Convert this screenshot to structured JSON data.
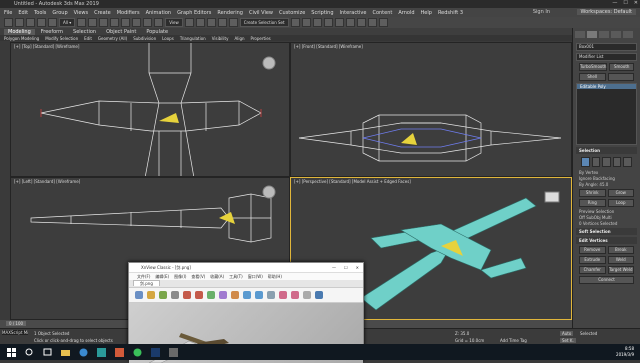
{
  "window": {
    "title": "Untitled - Autodesk 3ds Max 2019",
    "controls": [
      "—",
      "☐",
      "✕"
    ]
  },
  "menubar": {
    "items": [
      "File",
      "Edit",
      "Tools",
      "Group",
      "Views",
      "Create",
      "Modifiers",
      "Animation",
      "Graph Editors",
      "Rendering",
      "Civil View",
      "Customize",
      "Scripting",
      "Interactive",
      "Content",
      "Arnold",
      "Help",
      "Redshift 3"
    ],
    "sign_in": "Sign In",
    "workspace_label": "Workspaces:",
    "workspace_value": "Default"
  },
  "toolbar": {
    "view_dropdown": "View",
    "selection_set": "Create Selection Set"
  },
  "ribbon": {
    "tabs": [
      "Modeling",
      "Freeform",
      "Selection",
      "Object Paint",
      "Populate"
    ],
    "active_tab": "Modeling",
    "row": [
      "Polygon Modeling",
      "Modify Selection",
      "Edit",
      "Geometry (All)",
      "Subdivision",
      "Loops",
      "Triangulation",
      "Visibility",
      "Align",
      "Properties"
    ]
  },
  "viewports": {
    "top": "[+] [Top] [Standard] [Wireframe]",
    "front": "[+] [Front] [Standard] [Wireframe]",
    "left": "[+] [Left] [Standard] [Wireframe]",
    "perspective": "[+] [Perspective] [Standard] [Model Assist + Edged Faces]"
  },
  "command_panel": {
    "object_name": "Box001",
    "modifier_list": "Modifier List",
    "btn_turbosmooth": "TurboSmooth",
    "btn_smooth": "Smooth",
    "btn_shell": "Shell",
    "stack_item": "Editable Poly",
    "selection_header": "Selection",
    "by_vertex": "By Vertex",
    "ignore_backfacing": "Ignore Backfacing",
    "by_angle": "By Angle:",
    "angle_value": "45.0",
    "btn_shrink": "Shrink",
    "btn_grow": "Grow",
    "btn_ring": "Ring",
    "btn_loop": "Loop",
    "preview_selection": "Preview Selection",
    "preview_off": "Off",
    "preview_subobj": "SubObj",
    "preview_multi": "Multi",
    "selected_count": "0 Vertices Selected",
    "soft_selection": "Soft Selection",
    "edit_vertices": "Edit Vertices",
    "btn_remove": "Remove",
    "btn_break": "Break",
    "btn_extrude": "Extrude",
    "btn_weld": "Weld",
    "btn_chamfer": "Chamfer",
    "btn_target_weld": "Target Weld",
    "btn_connect": "Connect"
  },
  "status": {
    "selected": "1 Object Selected",
    "prompt": "Click or click-and-drag to select objects",
    "maxscript": "MAXScript Mi",
    "frame": "0 / 100",
    "z_value": "Z: 35.0",
    "add_time_tag": "Add Time Tag",
    "grid": "Grid = 10.0cm",
    "auto_key": "Auto",
    "set_key": "Set K.",
    "selected_dropdown": "Selected"
  },
  "image_viewer": {
    "title": "XnView Classic - [剑.png]",
    "menu": [
      "文件(F)",
      "编辑(E)",
      "图像(I)",
      "查看(V)",
      "收藏(A)",
      "工具(T)",
      "窗口(W)",
      "帮助(H)"
    ],
    "tab": "剑.png"
  },
  "taskbar": {
    "time": "8:58",
    "date": "2019/3/9"
  },
  "colors": {
    "mesh_cyan": "#6fd0c8",
    "wire_white": "#e8e8e8",
    "selection_yellow": "#e6d23c",
    "accent_blue": "#5b86b3",
    "viewport_bg": "#3d3d3d"
  }
}
